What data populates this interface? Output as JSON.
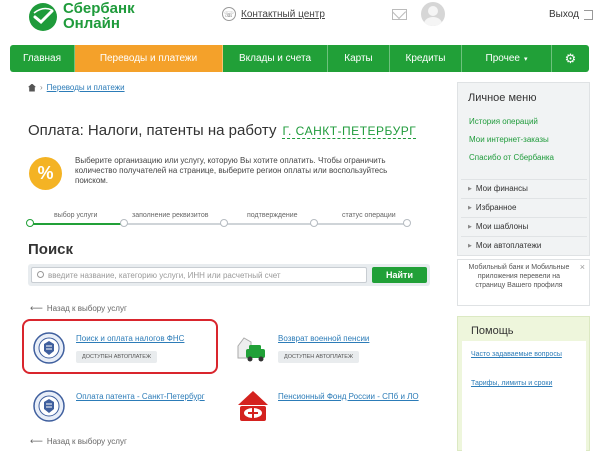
{
  "header": {
    "logo_line1": "Сбербанк",
    "logo_line2": "Онлайн",
    "contact": "Контактный центр",
    "exit": "Выход"
  },
  "nav": {
    "items": [
      {
        "label": "Главная"
      },
      {
        "label": "Переводы и платежи"
      },
      {
        "label": "Вклады и счета"
      },
      {
        "label": "Карты"
      },
      {
        "label": "Кредиты"
      },
      {
        "label": "Прочее"
      }
    ]
  },
  "breadcrumb": {
    "item": "Переводы и платежи"
  },
  "page": {
    "title": "Оплата: Налоги, патенты на работу",
    "region": "Г. САНКТ-ПЕТЕРБУРГ",
    "info_icon": "%",
    "info": "Выберите организацию или услугу, которую Вы хотите оплатить. Чтобы ограничить количество получателей на странице, выберите регион оплаты или воспользуйтесь поиском."
  },
  "steps": [
    {
      "label": "выбор услуги"
    },
    {
      "label": "заполнение реквизитов"
    },
    {
      "label": "подтверждение"
    },
    {
      "label": "статус операции"
    }
  ],
  "search": {
    "heading": "Поиск",
    "placeholder": "введите название, категорию услуги, ИНН или расчетный счет",
    "button": "Найти"
  },
  "back_label": "Назад к выбору услуг",
  "services": [
    {
      "name": "Поиск и оплата налогов ФНС",
      "badge": "ДОСТУПЕН АВТОПЛАТЕЖ"
    },
    {
      "name": "Возврат военной пенсии",
      "badge": "ДОСТУПЕН АВТОПЛАТЕЖ"
    },
    {
      "name": "Оплата патента - Санкт-Петербург"
    },
    {
      "name": "Пенсионный Фонд России - СПб и ЛО"
    }
  ],
  "sidebar": {
    "title": "Личное меню",
    "links": [
      "История операций",
      "Мои интернет-заказы",
      "Спасибо от Сбербанка"
    ],
    "rows": [
      "Мои финансы",
      "Избранное",
      "Мои шаблоны",
      "Мои автоплатежи"
    ],
    "promo": "Мобильный банк и Мобильные приложения перевели на страницу Вашего профиля",
    "promo_close": "×"
  },
  "help": {
    "title": "Помощь",
    "links": [
      "Часто задаваемые вопросы",
      "Тарифы, лимиты и сроки"
    ]
  },
  "colors": {
    "brand_green": "#21a038",
    "active_orange": "#f4a12a",
    "link_blue": "#2c7cb8",
    "highlight_red": "#d9252d"
  }
}
